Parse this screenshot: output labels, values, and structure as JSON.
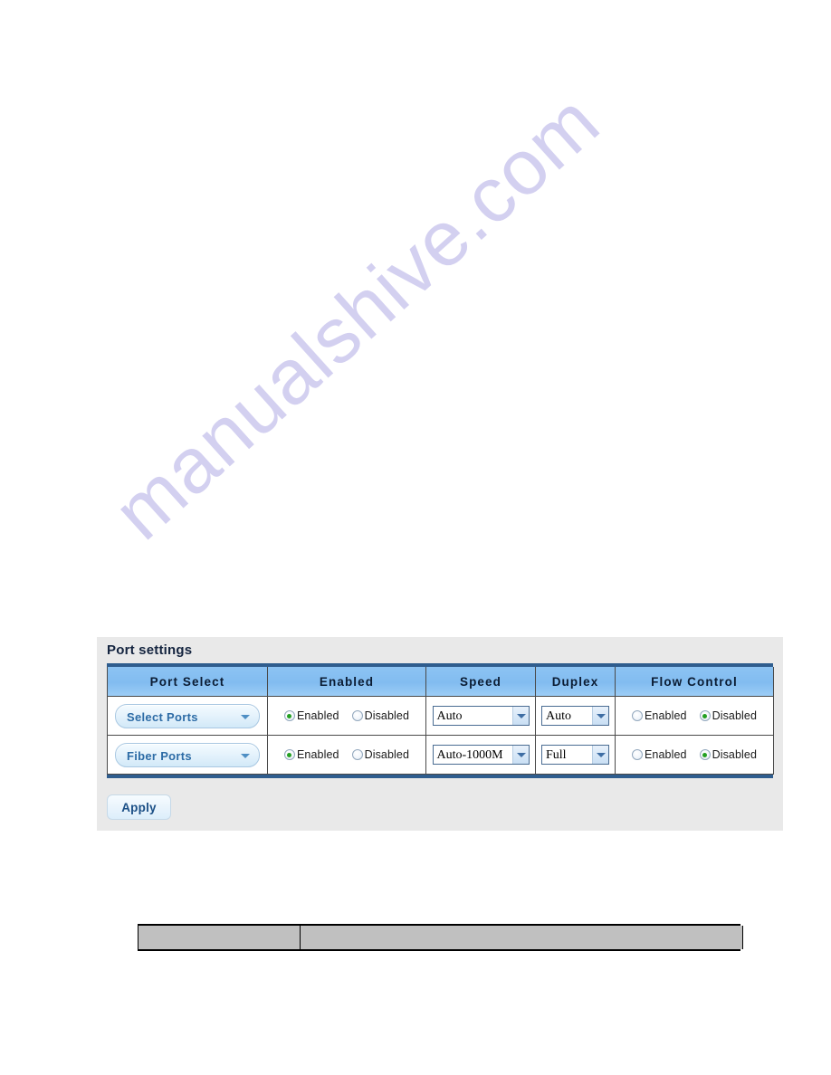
{
  "page": {
    "watermark": "manualshive.com",
    "watermark_color": "#b9b4e8",
    "background": "#ffffff"
  },
  "panel": {
    "title": "Port settings",
    "background": "#e9e9e9",
    "accent_border": "#2f5d8e",
    "header_background": "#8cc3f3",
    "header_text_color": "#0b1c33"
  },
  "table": {
    "headers": [
      "Port Select",
      "Enabled",
      "Speed",
      "Duplex",
      "Flow Control"
    ],
    "rows": [
      {
        "port_select": "Select Ports",
        "enabled": {
          "options": [
            "Enabled",
            "Disabled"
          ],
          "selected": "Enabled"
        },
        "speed": "Auto",
        "duplex": "Auto",
        "flow_control": {
          "options": [
            "Enabled",
            "Disabled"
          ],
          "selected": "Disabled"
        }
      },
      {
        "port_select": "Fiber Ports",
        "enabled": {
          "options": [
            "Enabled",
            "Disabled"
          ],
          "selected": "Enabled"
        },
        "speed": "Auto-1000M",
        "duplex": "Full",
        "flow_control": {
          "options": [
            "Enabled",
            "Disabled"
          ],
          "selected": "Disabled"
        }
      }
    ]
  },
  "buttons": {
    "apply": "Apply"
  },
  "icons": {
    "caret_down": "chevron-down-icon",
    "radio_selected": "radio-checked-icon",
    "radio_unselected": "radio-unchecked-icon"
  },
  "bottom_table": {
    "columns": [
      "",
      ""
    ],
    "rows": [
      [
        "",
        ""
      ]
    ]
  }
}
